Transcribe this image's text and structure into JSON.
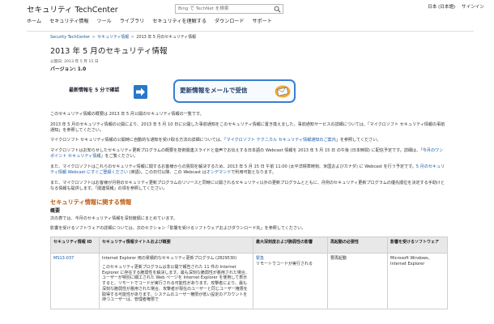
{
  "header": {
    "brand": "セキュリティ TechCenter",
    "search_placeholder": "Bing で TechNet を検索",
    "locale": "日本 (日本語)",
    "signin": "サインイン",
    "nav": [
      "ホーム",
      "セキュリティ情報",
      "ツール",
      "ライブラリ",
      "セキュリティを理解する",
      "ダウンロード",
      "サポート"
    ]
  },
  "breadcrumb": {
    "items": [
      "Security TechCenter",
      "セキュリティ情報"
    ],
    "current": "2013 年 5 月のセキュリティ情報"
  },
  "page": {
    "title": "2013 年 5 月のセキュリティ情報",
    "published": "公開日: 2013 年 5 月 15 日",
    "version": "バージョン: 1.0"
  },
  "banners": {
    "latest": "最新情報を 5 分で確認",
    "email": "更新情報をメールで受信"
  },
  "body": {
    "p1": "このセキュリティ情報の概要は 2013 年 5 月公開のセキュリティ情報の一覧です。",
    "p2": "2013 年 5 月のセキュリティ情報の公開により、2013 年 5 月 10 日に公開した事前通知をこのセキュリティ情報に置き換えました。事前通知サービスの詳細については、「マイクロソフト セキュリティ情報の事前通知」を参照してください。",
    "p3a": "マイクロソフト セキュリティ情報の公開時に自動的な通知を受け取る方法の詳細については、「",
    "p3link": "マイクロソフト テクニカル セキュリティ情報通知のご案内",
    "p3b": "」を参照してください。",
    "p4a": "マイクロソフトはお知らせしたセキュリティ更新プログラムの概要を技術関連スライドと音声でお伝えする日本語の Webcast 情報を 2013 年 5 月 15 日 の午後 (日本時間) に配信予定です。詳細は、「",
    "p4link": "今月のワンポイント セキュリティ情報",
    "p4b": "」をご覧ください。",
    "p5a": "また、マイクロソフトはこれらのセキュリティ情報に関するお客様からの質問を解決するため、2013 年 5 月 15 日 午前 11:00 (太平洋標準時刻、米国およびカナダ) に Webcast を行う予定です。",
    "p5link1": "5 月のセキュリティ情報 Webcast にすぐご登録ください",
    "p5b": " (英語)。この日付以降、この Webcast は",
    "p5link2": "オンデマンド",
    "p5c": "で利用可能となります。",
    "p6": "また、マイクロソフトはお客様が月例のセキュリティ更新プログラムのリリースと同時に公開されるセキュリティ以外の更新プログラムとともに、月例のセキュリティ更新プログラムの優先順位を決定する手助けとなる情報も提供します。「関連情報」の項を参照してください。"
  },
  "section": {
    "heading": "セキュリティ情報に関する情報",
    "subheading": "概要",
    "line1": "次の表では、今月のセキュリティ情報を深刻度順にまとめています。",
    "line2": "影響を受けるソフトウェアの詳細については、次のセクション「影響を受けるソフトウェアおよびダウンロード先」を参照してください。"
  },
  "table": {
    "headers": [
      "セキュリティ情報 ID",
      "セキュリティ情報タイトルおよび概要",
      "最大深刻度および脆弱性の影響",
      "再起動の必要性",
      "影響を受けるソフトウェア"
    ],
    "row": {
      "id": "MS13-037",
      "title": "Internet Explorer 用の累積的なセキュリティ更新プログラム (2829530)",
      "desc": "このセキュリティ更新プログラムは非公開で報告された 11 件の Internet Explorer に存在する脆弱性を解決します。最も深刻な脆弱性が悪用された場合、ユーザーが特別に細工された Web ページを Internet Explorer を使用して表示すると、リモートでコードが実行される可能性があります。攻撃者により、最も深刻な脆弱性が悪用された場合、攻撃者が現在のユーザーと同じユーザー権限を取得する可能性があります。システムのユーザー権限が低い設定のアカウントを持つユーザーは、管理者権限で",
      "severity": "緊急",
      "impact": "リモートでコードが実行される",
      "restart": "要再起動",
      "software": "Microsoft Windows、Internet Explorer"
    }
  },
  "colors": {
    "link": "#1a5aa6",
    "section_heading": "#c05a10",
    "banner_blue": "#3a7fcf"
  }
}
